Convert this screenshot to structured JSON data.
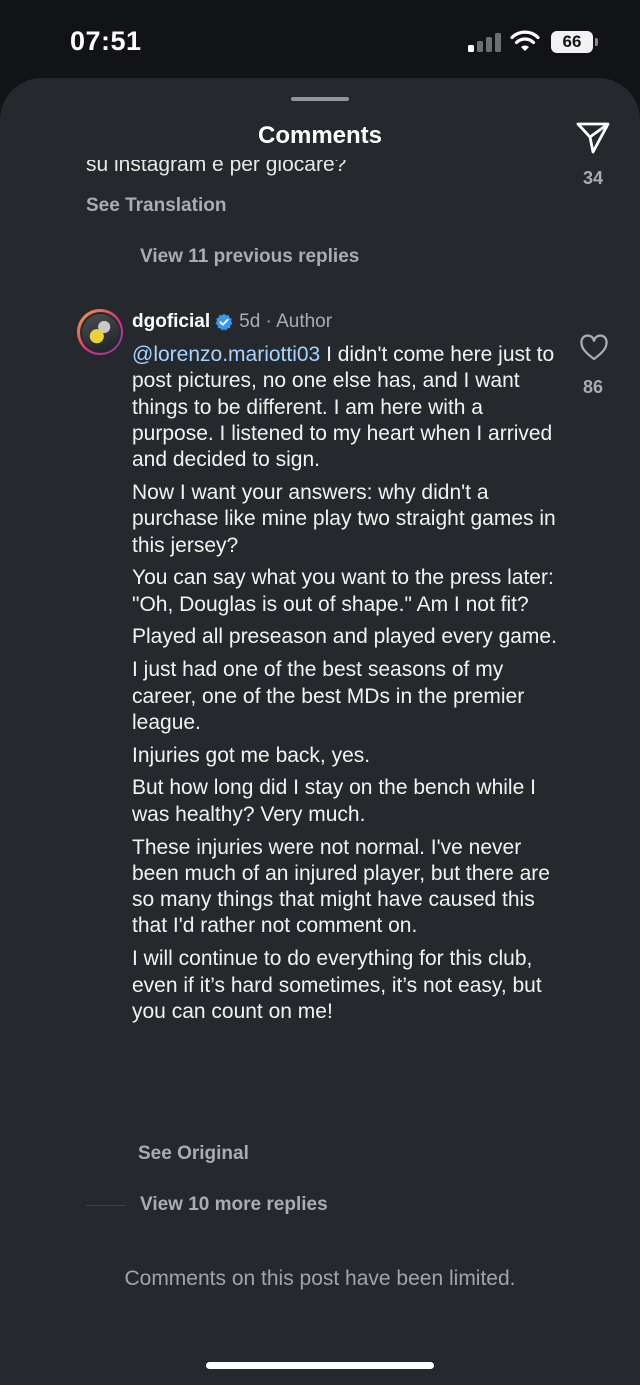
{
  "status_bar": {
    "time": "07:51",
    "battery": "66"
  },
  "header": {
    "title": "Comments"
  },
  "previous_comment": {
    "cut_text": "su instagram e per giocare?",
    "likes": "34",
    "see_translation": "See Translation"
  },
  "thread": {
    "view_previous": "View 11 previous replies"
  },
  "comment": {
    "username": "dgoficial",
    "meta": "5d · Author",
    "mention": "@lorenzo.mariotti03",
    "paragraphs": [
      " I didn't come here just to post pictures, no one else has, and I want things to be different. I am here with a purpose. I listened to my heart when I arrived and decided to sign.",
      "Now I want your answers: why didn't a purchase like mine play two straight games in this jersey?",
      "You can say what you want to the press later: \"Oh, Douglas is out of shape.\" Am I not fit?",
      "Played all preseason and played every game.",
      "I just had one of the best seasons of my career, one of the best MDs in the premier league.",
      "Injuries got me back, yes.",
      "But how long did I stay on the bench while I was healthy? Very much.",
      "These injuries were not normal. I've never been much of an injured player, but there are so many things that might have caused this that I'd rather not comment on.",
      "I will continue to do everything for this club, even if it’s hard sometimes, it’s not easy, but you can count on me!"
    ],
    "likes": "86",
    "see_original": "See Original"
  },
  "replies": {
    "view_more": "View 10 more replies"
  },
  "footer": {
    "limited_notice": "Comments on this post have been limited."
  },
  "icons": {
    "share": "paper-plane-icon",
    "like": "heart-icon",
    "verified": "verified-badge-icon",
    "signal": "cellular-signal-icon",
    "wifi": "wifi-icon",
    "battery": "battery-icon"
  },
  "colors": {
    "sheet_bg": "#25292e",
    "mention": "#a6d4ff",
    "verified": "#3897f0",
    "muted": "#a8adb3"
  }
}
